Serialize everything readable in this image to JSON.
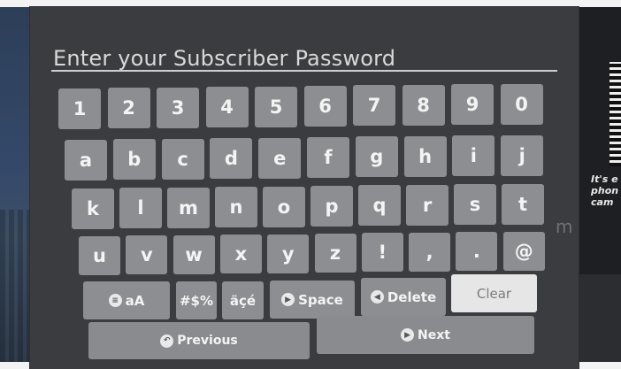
{
  "title": "Enter your Subscriber Password",
  "rows": [
    [
      "1",
      "2",
      "3",
      "4",
      "5",
      "6",
      "7",
      "8",
      "9",
      "0"
    ],
    [
      "a",
      "b",
      "c",
      "d",
      "e",
      "f",
      "g",
      "h",
      "i",
      "j"
    ],
    [
      "k",
      "l",
      "m",
      "n",
      "o",
      "p",
      "q",
      "r",
      "s",
      "t"
    ],
    [
      "u",
      "v",
      "w",
      "x",
      "y",
      "z",
      "!",
      ",",
      ".",
      "@"
    ]
  ],
  "function_keys": {
    "case": "aA",
    "symbols": "#$%",
    "accents": "äçé",
    "space": "Space",
    "delete": "Delete",
    "clear": "Clear"
  },
  "nav": {
    "previous": "Previous",
    "next": "Next"
  },
  "side_text": "It's e phon cam",
  "side_glyph": "m"
}
